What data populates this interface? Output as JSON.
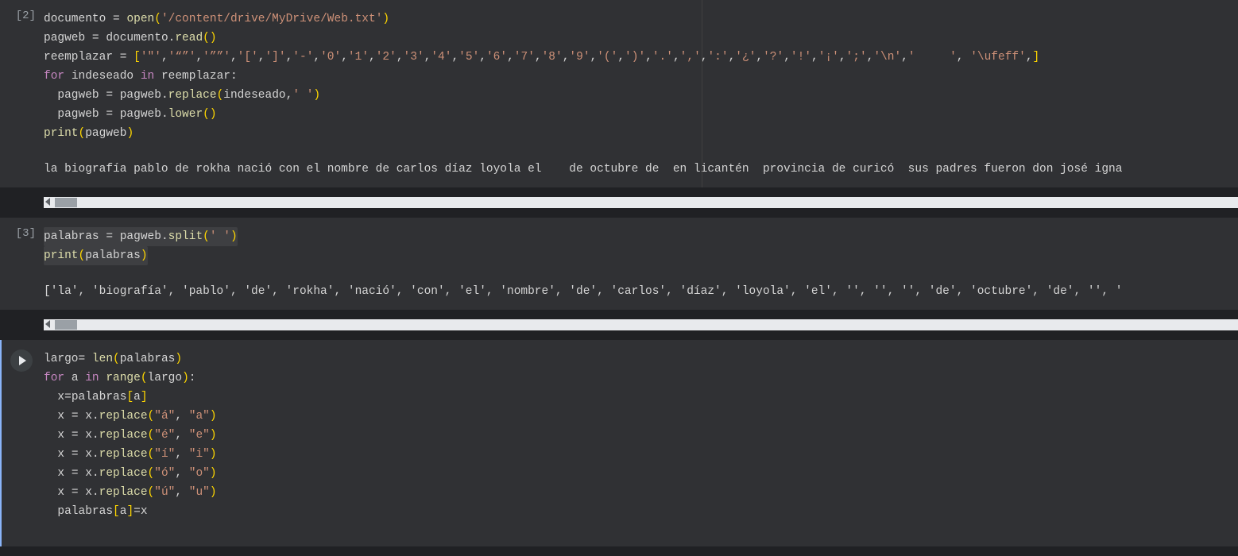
{
  "cells": [
    {
      "label": "[2]",
      "code_html": "<span class='tok-var'>documento</span> <span class='tok-op'>=</span> <span class='tok-fn'>open</span><span class='tok-par'>(</span><span class='tok-str'>'/content/drive/MyDrive/Web.txt'</span><span class='tok-par'>)</span>\n<span class='tok-var'>pagweb</span> <span class='tok-op'>=</span> <span class='tok-var'>documento</span>.<span class='tok-fn'>read</span><span class='tok-par'>()</span>\n<span class='tok-var'>reemplazar</span> <span class='tok-op'>=</span> <span class='tok-par'>[</span><span class='tok-str'>'\"'</span>,<span class='tok-str'>'“”'</span>,<span class='tok-str'>'””'</span>,<span class='tok-str'>'['</span>,<span class='tok-str'>']'</span>,<span class='tok-str'>'-'</span>,<span class='tok-str'>'0'</span>,<span class='tok-str'>'1'</span>,<span class='tok-str'>'2'</span>,<span class='tok-str'>'3'</span>,<span class='tok-str'>'4'</span>,<span class='tok-str'>'5'</span>,<span class='tok-str'>'6'</span>,<span class='tok-str'>'7'</span>,<span class='tok-str'>'8'</span>,<span class='tok-str'>'9'</span>,<span class='tok-str'>'('</span>,<span class='tok-str'>')'</span>,<span class='tok-str'>'.'</span>,<span class='tok-str'>','</span>,<span class='tok-str'>':'</span>,<span class='tok-str'>'¿'</span>,<span class='tok-str'>'?'</span>,<span class='tok-str'>'!'</span>,<span class='tok-str'>'¡'</span>,<span class='tok-str'>';'</span>,<span class='tok-str'>'\\n'</span>,<span class='tok-str'>'     '</span>, <span class='tok-str'>'\\ufeff'</span>,<span class='tok-par'>]</span>\n<span class='tok-kw'>for</span> <span class='tok-var'>indeseado</span> <span class='tok-kw'>in</span> <span class='tok-var'>reemplazar</span>:\n  <span class='tok-var'>pagweb</span> <span class='tok-op'>=</span> <span class='tok-var'>pagweb</span>.<span class='tok-fn'>replace</span><span class='tok-par'>(</span><span class='tok-var'>indeseado</span>,<span class='tok-str'>' '</span><span class='tok-par'>)</span>\n  <span class='tok-var'>pagweb</span> <span class='tok-op'>=</span> <span class='tok-var'>pagweb</span>.<span class='tok-fn'>lower</span><span class='tok-par'>()</span>\n<span class='tok-fn'>print</span><span class='tok-par'>(</span><span class='tok-var'>pagweb</span><span class='tok-par'>)</span>",
      "output": "la biografía pablo de rokha nació con el nombre de carlos díaz loyola el    de octubre de  en licantén  provincia de curicó  sus padres fueron don josé igna",
      "has_ruler": true
    },
    {
      "label": "[3]",
      "code_html": "<span class='hl-line'><span class='tok-var'>palabras</span> <span class='tok-op'>=</span> <span class='tok-var'>pagweb</span>.<span class='tok-fn'>split</span><span class='tok-par'>(</span><span class='tok-str'>' '</span><span class='tok-par'>)</span></span>\n<span class='hl-line'><span class='tok-fn'>print</span><span class='tok-par'>(</span><span class='tok-var'>palabras</span><span class='tok-par'>)</span></span>",
      "output": "['la', 'biografía', 'pablo', 'de', 'rokha', 'nació', 'con', 'el', 'nombre', 'de', 'carlos', 'díaz', 'loyola', 'el', '', '', '', 'de', 'octubre', 'de', '', '",
      "has_ruler": false
    },
    {
      "label": "play",
      "code_html": "<span class='tok-var'>largo</span><span class='tok-op'>=</span> <span class='tok-fn'>len</span><span class='tok-par'>(</span><span class='tok-var'>palabras</span><span class='tok-par'>)</span>\n<span class='tok-kw'>for</span> <span class='tok-var'>a</span> <span class='tok-kw'>in</span> <span class='tok-fn'>range</span><span class='tok-par'>(</span><span class='tok-var'>largo</span><span class='tok-par'>)</span>:\n  <span class='tok-var'>x</span><span class='tok-op'>=</span><span class='tok-var'>palabras</span><span class='tok-par'>[</span><span class='tok-var'>a</span><span class='tok-par'>]</span>\n  <span class='tok-var'>x</span> <span class='tok-op'>=</span> <span class='tok-var'>x</span>.<span class='tok-fn'>replace</span><span class='tok-par'>(</span><span class='tok-str'>\"á\"</span>, <span class='tok-str'>\"a\"</span><span class='tok-par'>)</span>\n  <span class='tok-var'>x</span> <span class='tok-op'>=</span> <span class='tok-var'>x</span>.<span class='tok-fn'>replace</span><span class='tok-par'>(</span><span class='tok-str'>\"é\"</span>, <span class='tok-str'>\"e\"</span><span class='tok-par'>)</span>\n  <span class='tok-var'>x</span> <span class='tok-op'>=</span> <span class='tok-var'>x</span>.<span class='tok-fn'>replace</span><span class='tok-par'>(</span><span class='tok-str'>\"í\"</span>, <span class='tok-str'>\"i\"</span><span class='tok-par'>)</span>\n  <span class='tok-var'>x</span> <span class='tok-op'>=</span> <span class='tok-var'>x</span>.<span class='tok-fn'>replace</span><span class='tok-par'>(</span><span class='tok-str'>\"ó\"</span>, <span class='tok-str'>\"o\"</span><span class='tok-par'>)</span>\n  <span class='tok-var'>x</span> <span class='tok-op'>=</span> <span class='tok-var'>x</span>.<span class='tok-fn'>replace</span><span class='tok-par'>(</span><span class='tok-str'>\"ú\"</span>, <span class='tok-str'>\"u\"</span><span class='tok-par'>)</span>\n  <span class='tok-var'>palabras</span><span class='tok-par'>[</span><span class='tok-var'>a</span><span class='tok-par'>]</span><span class='tok-op'>=</span><span class='tok-var'>x</span>",
      "output": null,
      "has_ruler": false
    }
  ]
}
